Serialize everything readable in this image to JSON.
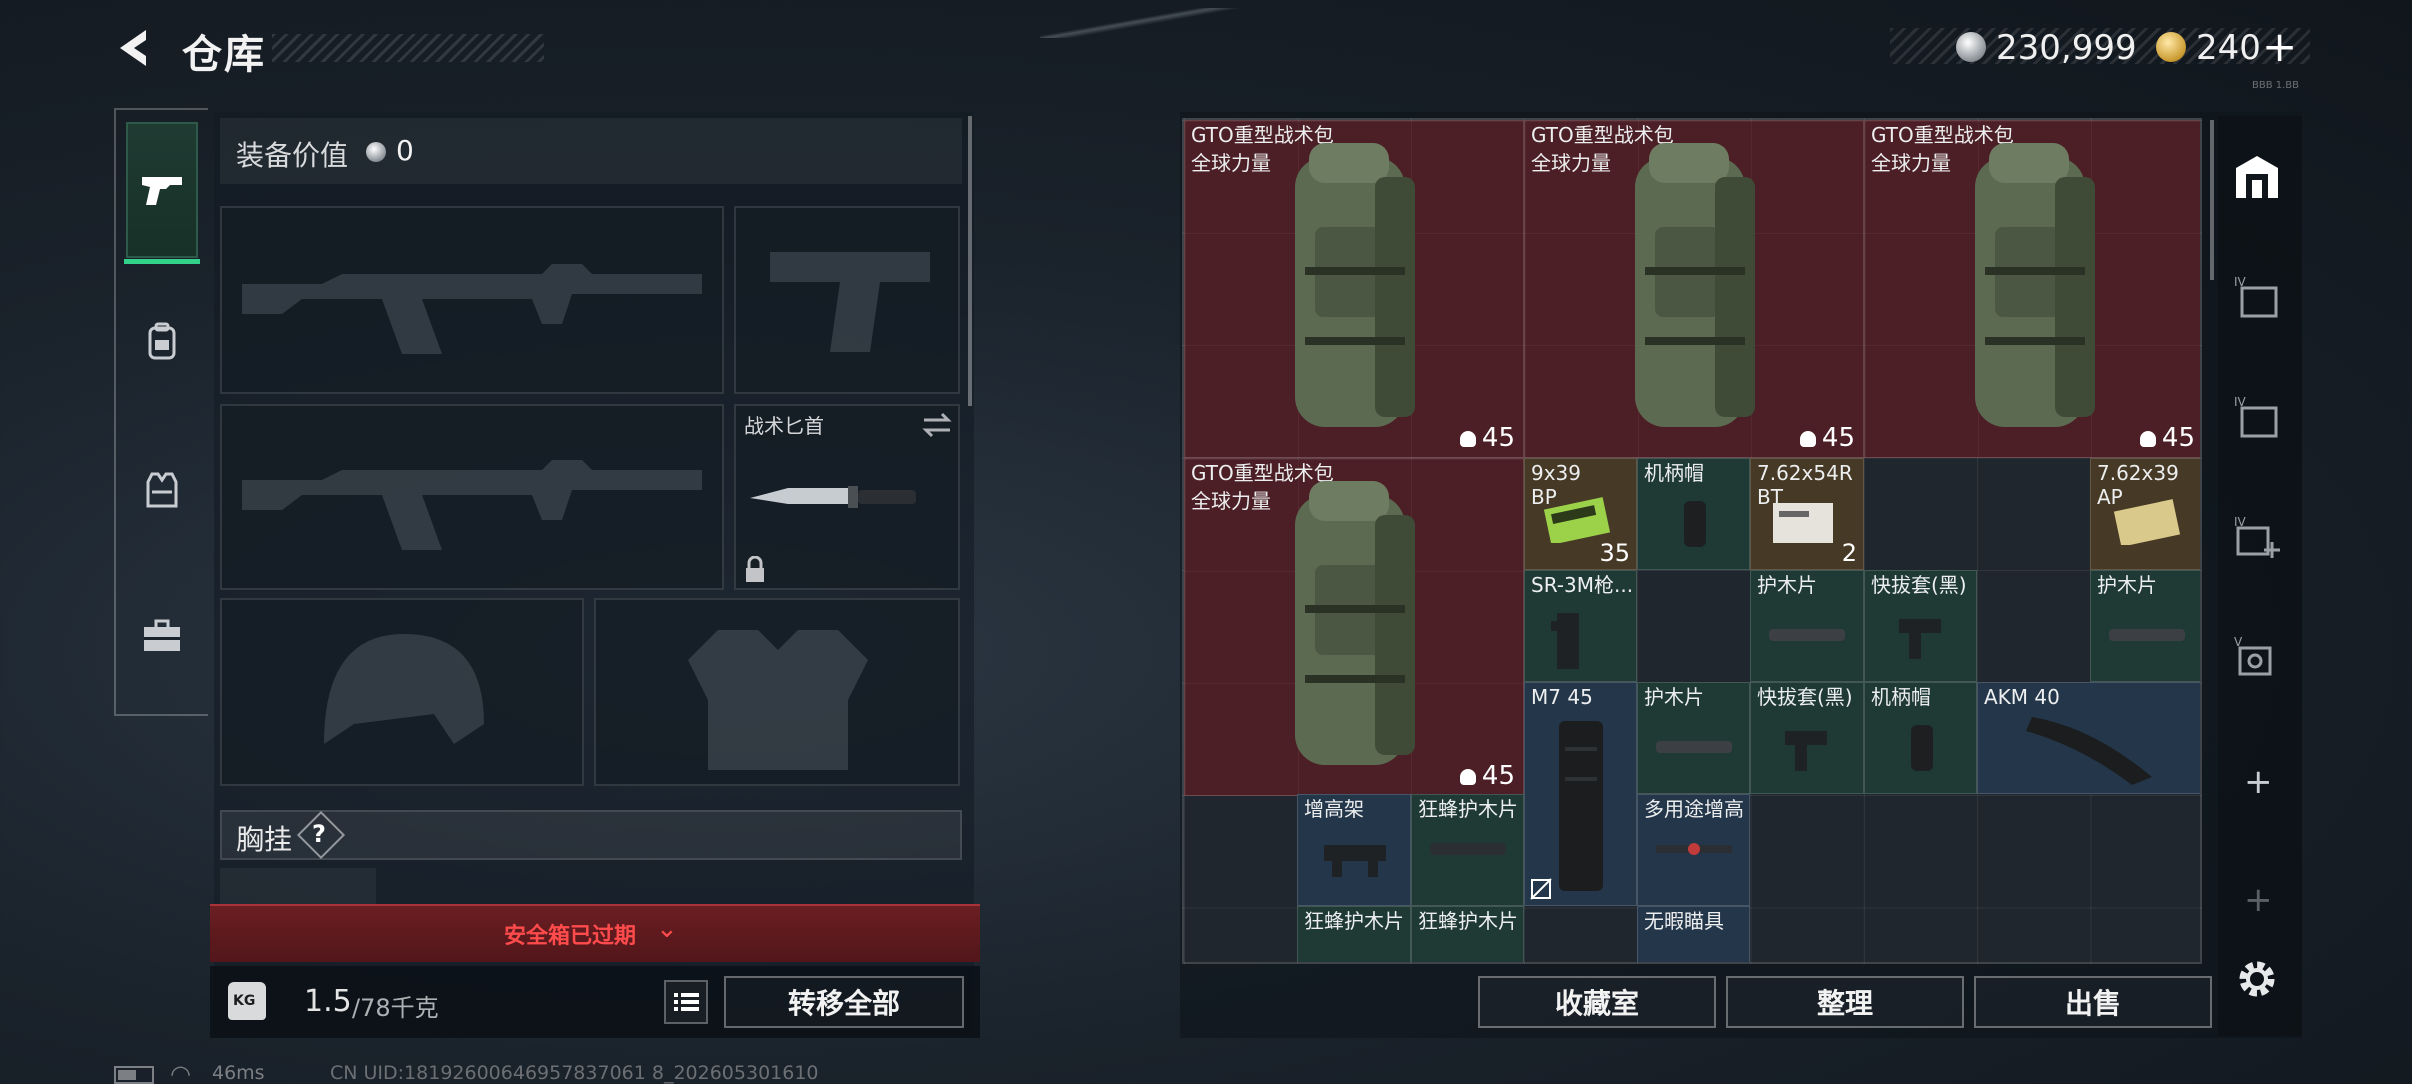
{
  "header": {
    "title": "仓库",
    "silver_amount": "230,999",
    "gold_amount": "240",
    "add_label": "+",
    "corner_text": "BBB 1.BB"
  },
  "equipment": {
    "value_label": "装备价值",
    "value": "0",
    "knife_label": "战术匕首",
    "chest_rig_label": "胸挂",
    "chest_rig_help": "?"
  },
  "safe_box": {
    "text": "安全箱已过期",
    "chevron": "⌄"
  },
  "capacity": {
    "current": "1.5",
    "max": "/78千克",
    "icon_label": "KG"
  },
  "buttons": {
    "transfer_all": "转移全部",
    "collection_room": "收藏室",
    "organize": "整理",
    "sell": "出售"
  },
  "status": {
    "ping": "46ms",
    "uid": "CN UID:18192600646957837061 8_202605301610"
  },
  "items": [
    {
      "name": "GTO重型战术包",
      "sub": "全球力量",
      "capacity": "45"
    },
    {
      "name": "GTO重型战术包",
      "sub": "全球力量",
      "capacity": "45"
    },
    {
      "name": "GTO重型战术包",
      "sub": "全球力量",
      "capacity": "45"
    },
    {
      "name": "GTO重型战术包",
      "sub": "全球力量",
      "capacity": "45"
    },
    {
      "name": "9x39",
      "sub": "BP",
      "count": "35"
    },
    {
      "name": "机柄帽"
    },
    {
      "name": "7.62x54R",
      "sub": "BT",
      "count": "2"
    },
    {
      "name": "7.62x39",
      "sub": "AP"
    },
    {
      "name": "SR-3M枪..."
    },
    {
      "name": "护木片"
    },
    {
      "name": "快拔套(黑)"
    },
    {
      "name": "护木片"
    },
    {
      "name": "M7 45"
    },
    {
      "name": "护木片"
    },
    {
      "name": "快拔套(黑)"
    },
    {
      "name": "机柄帽"
    },
    {
      "name": "AKM 40"
    },
    {
      "name": "增高架"
    },
    {
      "name": "狂蜂护木片"
    },
    {
      "name": "多用途增高"
    },
    {
      "name": "狂蜂护木片"
    },
    {
      "name": "狂蜂护木片"
    },
    {
      "name": "无暇瞄具"
    }
  ],
  "colors": {
    "backpack_bg": "#4b1f25",
    "green_bg": "#1f3934",
    "blue_bg": "#243649",
    "accent_green": "#33d28a",
    "warning_red": "#ff4b4b"
  },
  "icons": {
    "back": "chevron-left-icon",
    "nav": [
      "pistol-icon",
      "backpack-icon",
      "vest-icon",
      "briefcase-icon"
    ],
    "rail": [
      "warehouse-home-icon",
      "storage-iv-icon",
      "storage-iv-icon",
      "storage-add-icon",
      "storage-v-icon"
    ],
    "settings": "gear-icon"
  }
}
